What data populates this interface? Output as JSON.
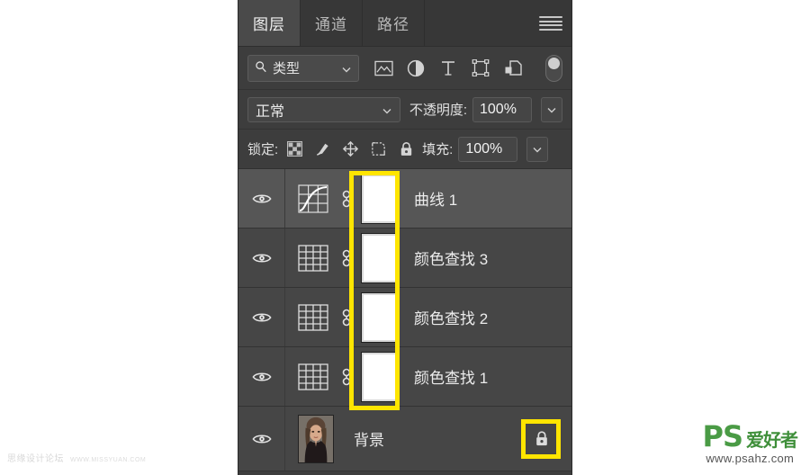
{
  "panel": {
    "title": "图层",
    "tabs": [
      {
        "label": "图层",
        "active": true
      },
      {
        "label": "通道",
        "active": false
      },
      {
        "label": "路径",
        "active": false
      }
    ],
    "menu_icon": "hamburger-menu-icon"
  },
  "filter_row": {
    "search_icon": "search-icon",
    "filter_type_label": "类型",
    "caret_icon": "chevron-down-icon",
    "icons": [
      {
        "name": "pixel-layer-filter-icon",
        "glyph": "image"
      },
      {
        "name": "adjustment-layer-filter-icon",
        "glyph": "half-circle"
      },
      {
        "name": "type-layer-filter-icon",
        "glyph": "T"
      },
      {
        "name": "shape-layer-filter-icon",
        "glyph": "shape"
      },
      {
        "name": "smart-object-filter-icon",
        "glyph": "smart-object"
      }
    ],
    "toggle_name": "filter-enable-toggle"
  },
  "blend_row": {
    "blend_mode": "正常",
    "opacity_label": "不透明度:",
    "opacity_value": "100%",
    "caret_icon": "chevron-down-icon"
  },
  "lock_row": {
    "lock_label": "锁定:",
    "lock_icons": [
      {
        "name": "lock-transparent-pixels-icon"
      },
      {
        "name": "lock-image-pixels-icon"
      },
      {
        "name": "lock-position-icon"
      },
      {
        "name": "lock-artboard-nesting-icon"
      },
      {
        "name": "lock-all-icon"
      }
    ],
    "fill_label": "填充:",
    "fill_value": "100%"
  },
  "layers": [
    {
      "name": "曲线 1",
      "type": "adjustment-curves",
      "visible": true,
      "selected": true,
      "has_mask": true,
      "linked": true,
      "locked": false
    },
    {
      "name": "颜色查找 3",
      "type": "adjustment-color-lookup",
      "visible": true,
      "selected": false,
      "has_mask": true,
      "linked": true,
      "locked": false
    },
    {
      "name": "颜色查找 2",
      "type": "adjustment-color-lookup",
      "visible": true,
      "selected": false,
      "has_mask": true,
      "linked": true,
      "locked": false
    },
    {
      "name": "颜色查找 1",
      "type": "adjustment-color-lookup",
      "visible": true,
      "selected": false,
      "has_mask": true,
      "linked": true,
      "locked": false
    },
    {
      "name": "背景",
      "type": "image-portrait",
      "visible": true,
      "selected": false,
      "has_mask": false,
      "linked": false,
      "locked": true
    }
  ],
  "highlights": [
    {
      "name": "mask-column-highlight",
      "color": "#ffe500"
    },
    {
      "name": "background-lock-highlight",
      "color": "#ffe500"
    }
  ],
  "watermarks": {
    "left_text": "思缘设计论坛",
    "left_url": "WWW.MISSYUAN.COM",
    "right_logo": "PS",
    "right_logo_cn": "爱好者",
    "right_url": "www.psahz.com"
  },
  "colors": {
    "panel_bg": "#3d3d3d",
    "row_bg": "#464646",
    "row_selected_bg": "#565656",
    "tab_active_bg": "#4a4a4a",
    "highlight": "#ffe500",
    "text": "#ececec"
  }
}
